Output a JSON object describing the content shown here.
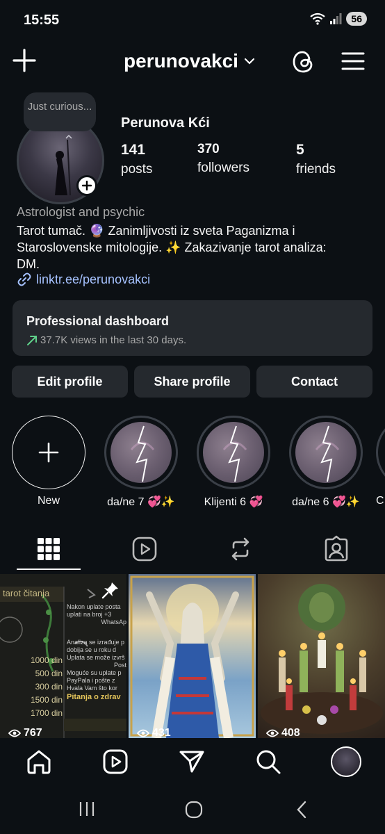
{
  "status": {
    "time": "15:55",
    "battery": "56"
  },
  "header": {
    "username": "perunovakci"
  },
  "profile": {
    "note": "Just curious...",
    "display_name": "Perunova Kći",
    "stats": [
      {
        "value": "141",
        "label": "posts"
      },
      {
        "value": "370",
        "label": "followers"
      },
      {
        "value": "5",
        "label": "friends"
      }
    ],
    "category": "Astrologist and psychic",
    "bio_lines": [
      "Tarot tumač. 🔮 Zanimljivosti iz sveta Paganizma i",
      "Staroslovenske mitologije. ✨ Zakazivanje tarot analiza:",
      "DM."
    ],
    "link": "linktr.ee/perunovakci"
  },
  "dashboard": {
    "title": "Professional dashboard",
    "subtitle": "37.7K views in the last 30 days."
  },
  "buttons": {
    "edit": "Edit profile",
    "share": "Share profile",
    "contact": "Contact"
  },
  "highlights": [
    {
      "label": "New"
    },
    {
      "label": "da/ne 7 💞✨"
    },
    {
      "label": "Klijenti 6 💞"
    },
    {
      "label": "da/ne 6 💞✨"
    },
    {
      "label": "C"
    }
  ],
  "posts": [
    {
      "views": "767",
      "lines_left": [
        "tarot čitanja",
        "1000 din",
        "500 din",
        "300 din",
        "1500 din",
        "1700 din"
      ],
      "lines_right": [
        "Nakon uplate posta",
        "uplati na broj +3",
        "WhatsAp",
        "Analiza se izrađuje p",
        "dobija se u roku d",
        "Uplata se može izvrš",
        "Post",
        "Moguće su uplate p",
        "PayPala i pošte z",
        "Hvala Vam što kor",
        "Pitanja o zdrav"
      ]
    },
    {
      "views": "431"
    },
    {
      "views": "408"
    }
  ],
  "colors": {
    "background": "#0c1014",
    "card": "#25292e",
    "link": "#a6c2ff",
    "muted": "#a8a8a8"
  }
}
